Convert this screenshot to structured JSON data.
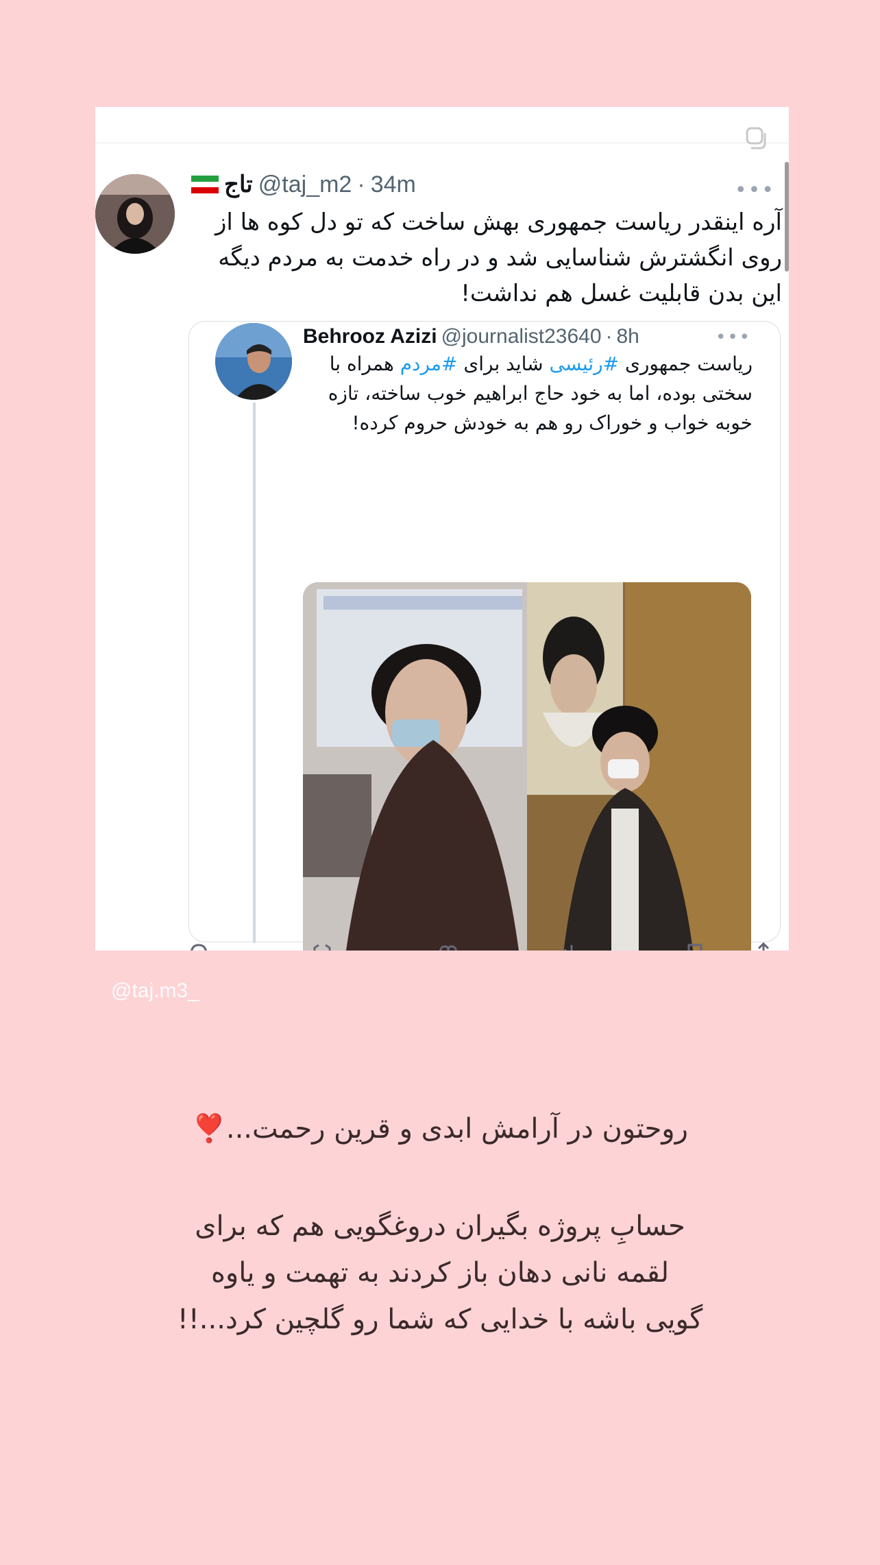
{
  "tweet": {
    "display_name": "تاج",
    "handle": "@taj_m2",
    "separator": "·",
    "time": "34m",
    "more_label": "•••",
    "text": "آره اینقدر ریاست جمهوری بهش ساخت که تو دل کوه ها از روی انگشترش شناسایی شد و در راه خدمت به مردم دیگه این بدن قابلیت غسل هم نداشت!"
  },
  "quoted_tweet": {
    "display_name": "Behrooz Azizi",
    "handle": "@journalist23640",
    "separator": "·",
    "time": "8h",
    "more_label": "•••",
    "text_part1": "ریاست جمهوری ",
    "hashtag1": "#رئیسی",
    "text_part2": " شاید برای ",
    "hashtag2": "#مردم",
    "text_part3": " همراه با سختی بوده، اما به خود حاج ابراهیم خوب ساخته، تازه خوبه خواب و خوراک رو هم به خودش حروم کرده!"
  },
  "watermark": "@taj.m3_",
  "caption_line1": "روحتون در آرامش ابدی و قرین رحمت...❣️",
  "caption_line2": "حسابِ پروژه بگیران دروغگویی هم که برای",
  "caption_line3": "لقمه نانی دهان باز کردند به تهمت و یاوه",
  "caption_line4": "گویی باشه با خدایی که شما رو گلچین کرد...!!",
  "colors": {
    "background": "#fdd3d6",
    "hashtag": "#1d9bf0",
    "flag_green": "#239f40",
    "flag_red": "#da0000"
  }
}
